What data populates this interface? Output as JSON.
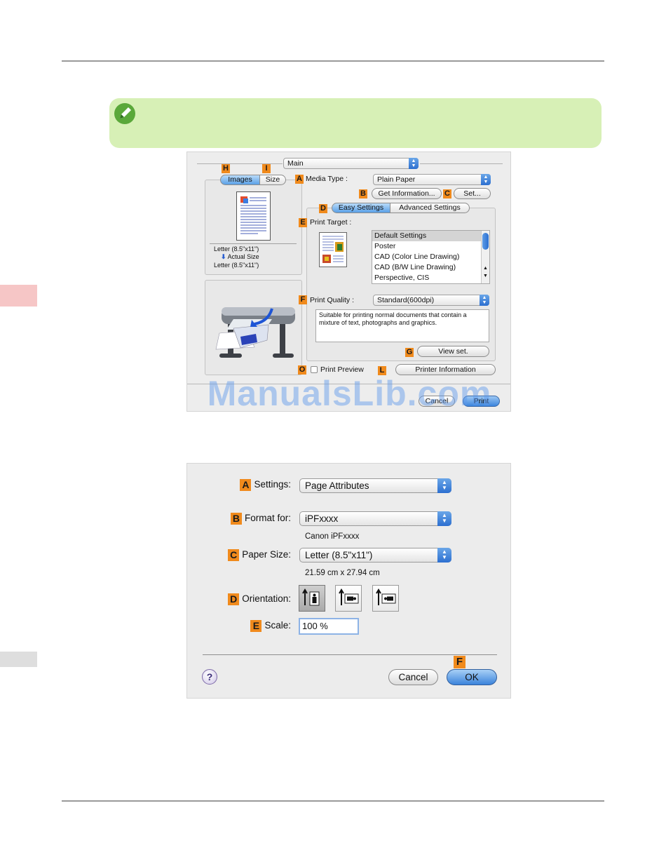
{
  "dialog1": {
    "main_popup": "Main",
    "tabs": {
      "images": "Images",
      "size": "Size"
    },
    "letters": {
      "H": "H",
      "I": "I",
      "A": "A",
      "B": "B",
      "C": "C",
      "D": "D",
      "E": "E",
      "F": "F",
      "G": "G",
      "O": "O",
      "L": "L"
    },
    "media_type_label": "Media Type :",
    "media_type_value": "Plain Paper",
    "get_information": "Get Information...",
    "set_button": "Set...",
    "easy_settings": "Easy Settings",
    "advanced_settings": "Advanced Settings",
    "print_target_label": "Print Target :",
    "print_target_items": [
      "Default Settings",
      "Poster",
      "CAD (Color Line Drawing)",
      "CAD (B/W Line Drawing)",
      "Perspective, CIS"
    ],
    "print_quality_label": "Print Quality :",
    "print_quality_value": "Standard(600dpi)",
    "description": "Suitable for printing normal documents that contain a mixture of text, photographs and graphics.",
    "view_set": "View set.",
    "print_preview": "Print Preview",
    "printer_information": "Printer Information",
    "size_from": "Letter (8.5\"x11\")",
    "actual_size": "Actual Size",
    "size_to": "Letter (8.5\"x11\")",
    "cancel": "Cancel",
    "print": "Print",
    "watermark": "ManualsLib.com"
  },
  "dialog2": {
    "settings_letter": "A",
    "settings_label": "Settings:",
    "settings_value": "Page Attributes",
    "format_letter": "B",
    "format_label": "Format for:",
    "format_value": "iPFxxxx",
    "format_sub": "Canon iPFxxxx",
    "paper_letter": "C",
    "paper_label": "Paper Size:",
    "paper_value": "Letter (8.5\"x11\")",
    "paper_sub": "21.59 cm x 27.94 cm",
    "orientation_letter": "D",
    "orientation_label": "Orientation:",
    "scale_letter": "E",
    "scale_label": "Scale:",
    "scale_value": "100 %",
    "ok_letter": "F",
    "help": "?",
    "cancel": "Cancel",
    "ok": "OK"
  },
  "colors": {
    "label_orange": "#f08a1c",
    "note_green": "#d7f0b6",
    "accent_blue": "#3a84dc",
    "sidetab_red": "#f6c6c6"
  }
}
